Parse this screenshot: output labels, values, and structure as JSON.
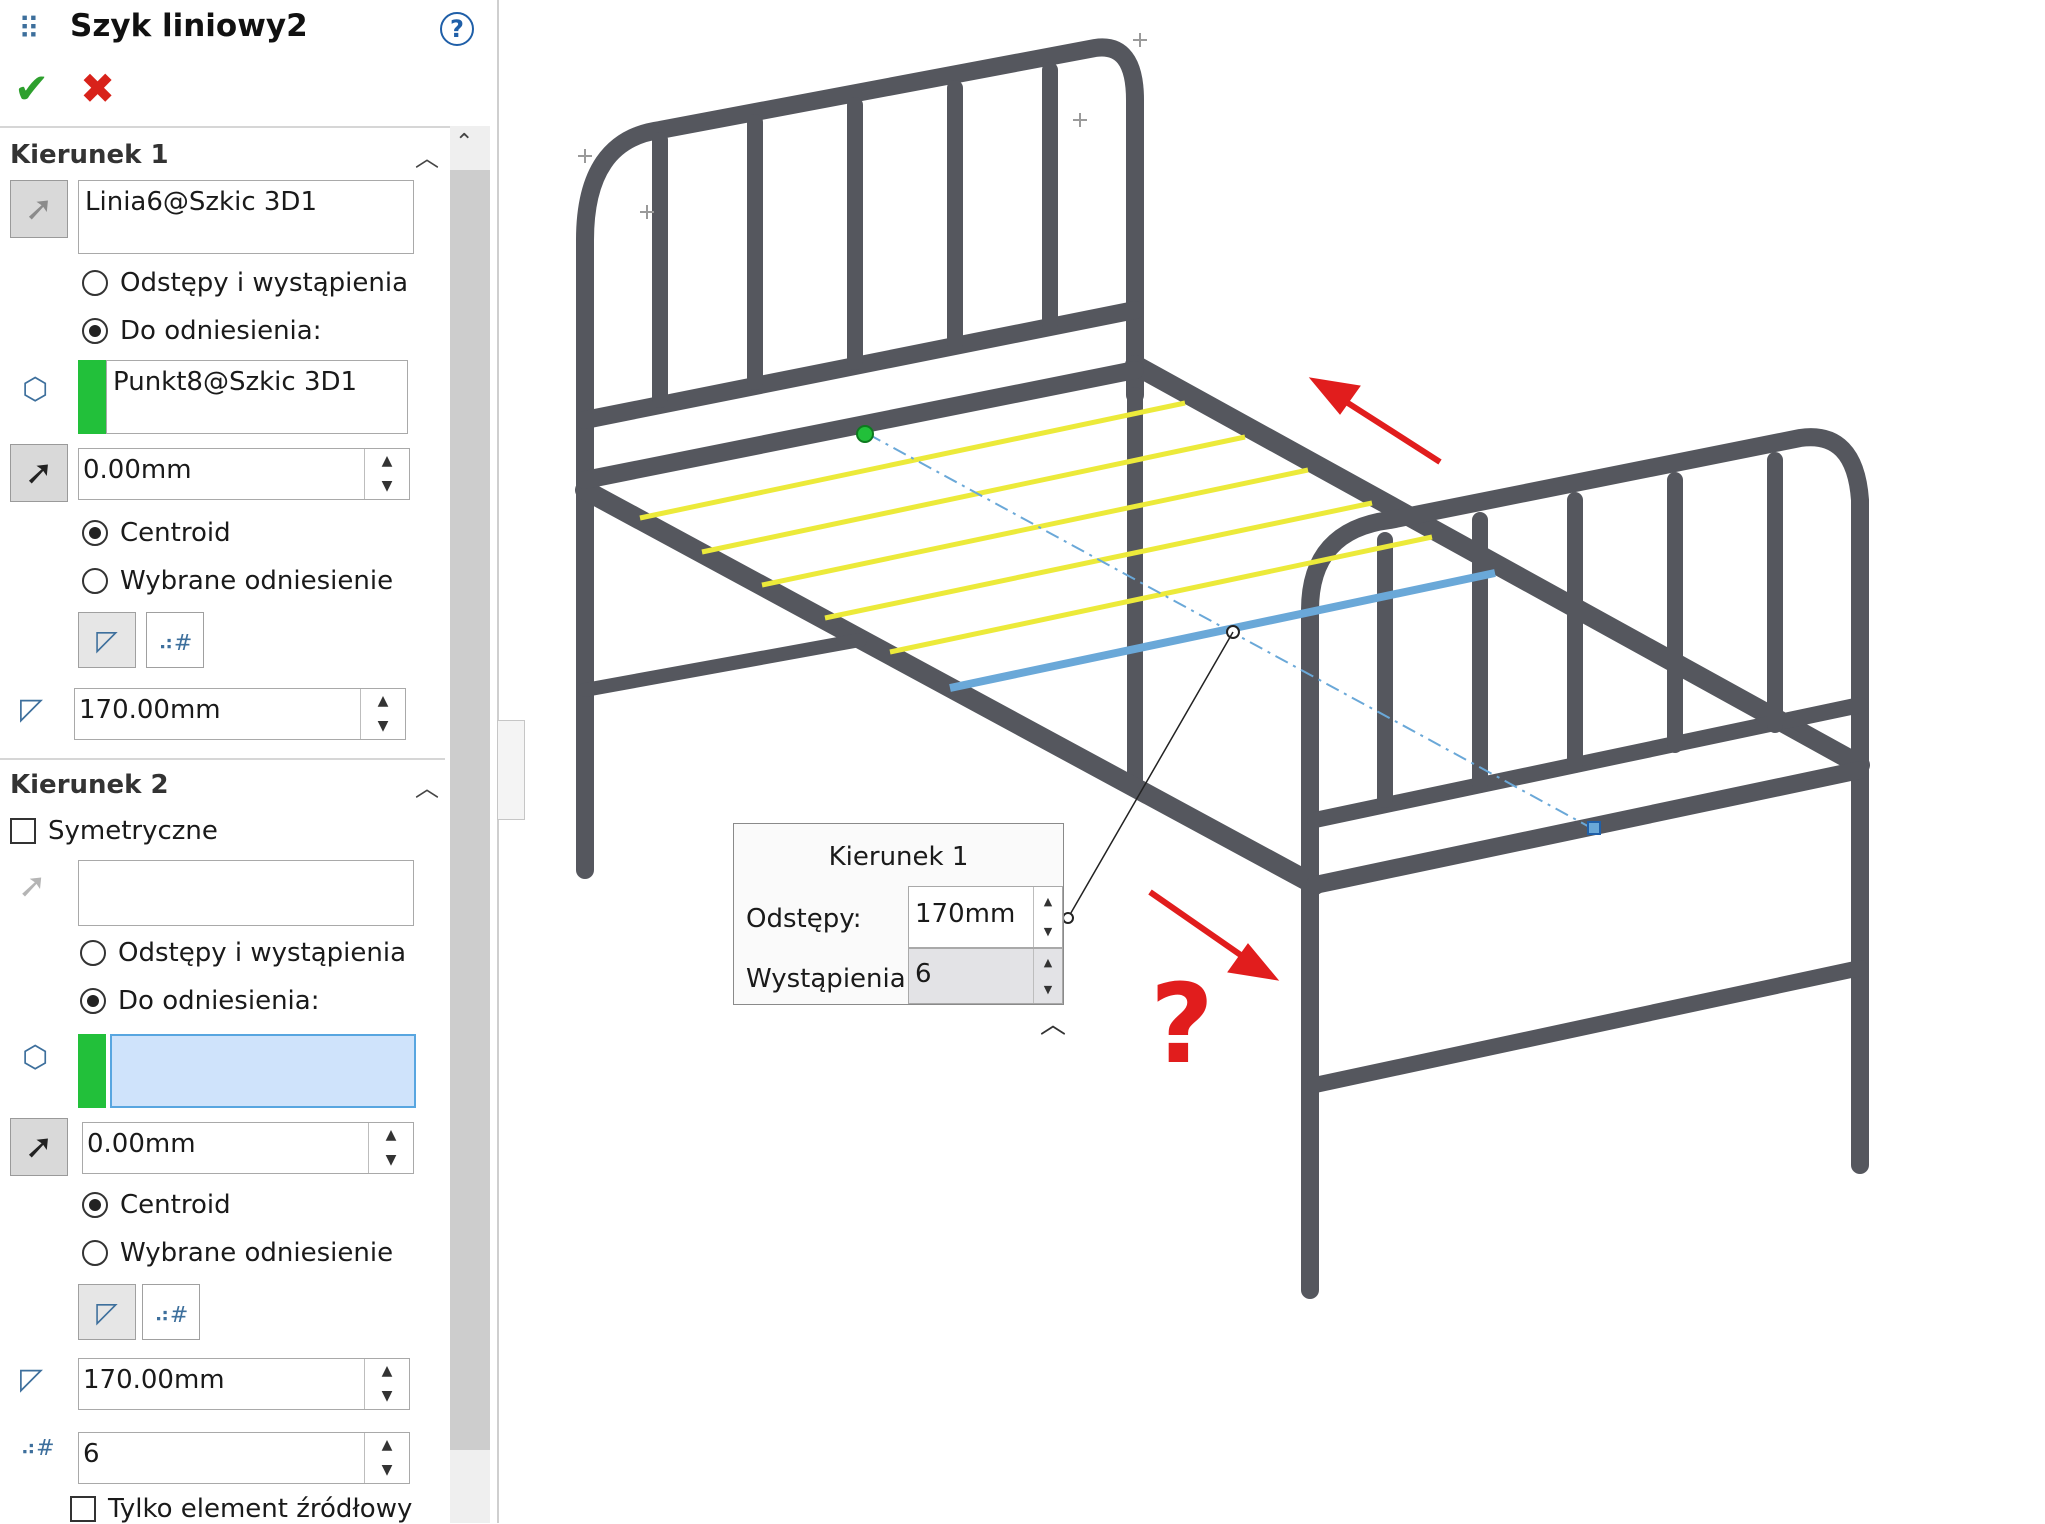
{
  "header": {
    "title": "Szyk liniowy2",
    "help": "?"
  },
  "actions": {
    "ok": "✔",
    "cancel": "✖"
  },
  "dir1": {
    "heading": "Kierunek 1",
    "direction_ref": "Linia6@Szkic 3D1",
    "option_spacing": "Odstępy i wystąpienia",
    "option_reference": "Do odniesienia:",
    "reference_point": "Punkt8@Szkic 3D1",
    "offset": "0.00mm",
    "centroid": "Centroid",
    "selected_ref": "Wybrane odniesienie",
    "spacing": "170.00mm"
  },
  "dir2": {
    "heading": "Kierunek 2",
    "symmetric": "Symetryczne",
    "direction_ref": "",
    "option_spacing": "Odstępy i wystąpienia",
    "option_reference": "Do odniesienia:",
    "reference_point": "",
    "offset": "0.00mm",
    "centroid": "Centroid",
    "selected_ref": "Wybrane odniesienie",
    "spacing": "170.00mm",
    "instances": "6",
    "seed_only": "Tylko element źródłowy"
  },
  "callout": {
    "title": "Kierunek 1",
    "spacing_label": "Odstępy:",
    "spacing_value": "170mm",
    "instances_label": "Wystąpienia:",
    "instances_value": "6"
  },
  "viewport": {
    "question_mark": "?"
  },
  "colors": {
    "accent_green": "#22c03a",
    "arrow_red": "#e11d1d",
    "selection_blue": "#cfe3fb",
    "frame_gray": "#5d5f66",
    "preview_yellow": "#f2ef3a"
  }
}
